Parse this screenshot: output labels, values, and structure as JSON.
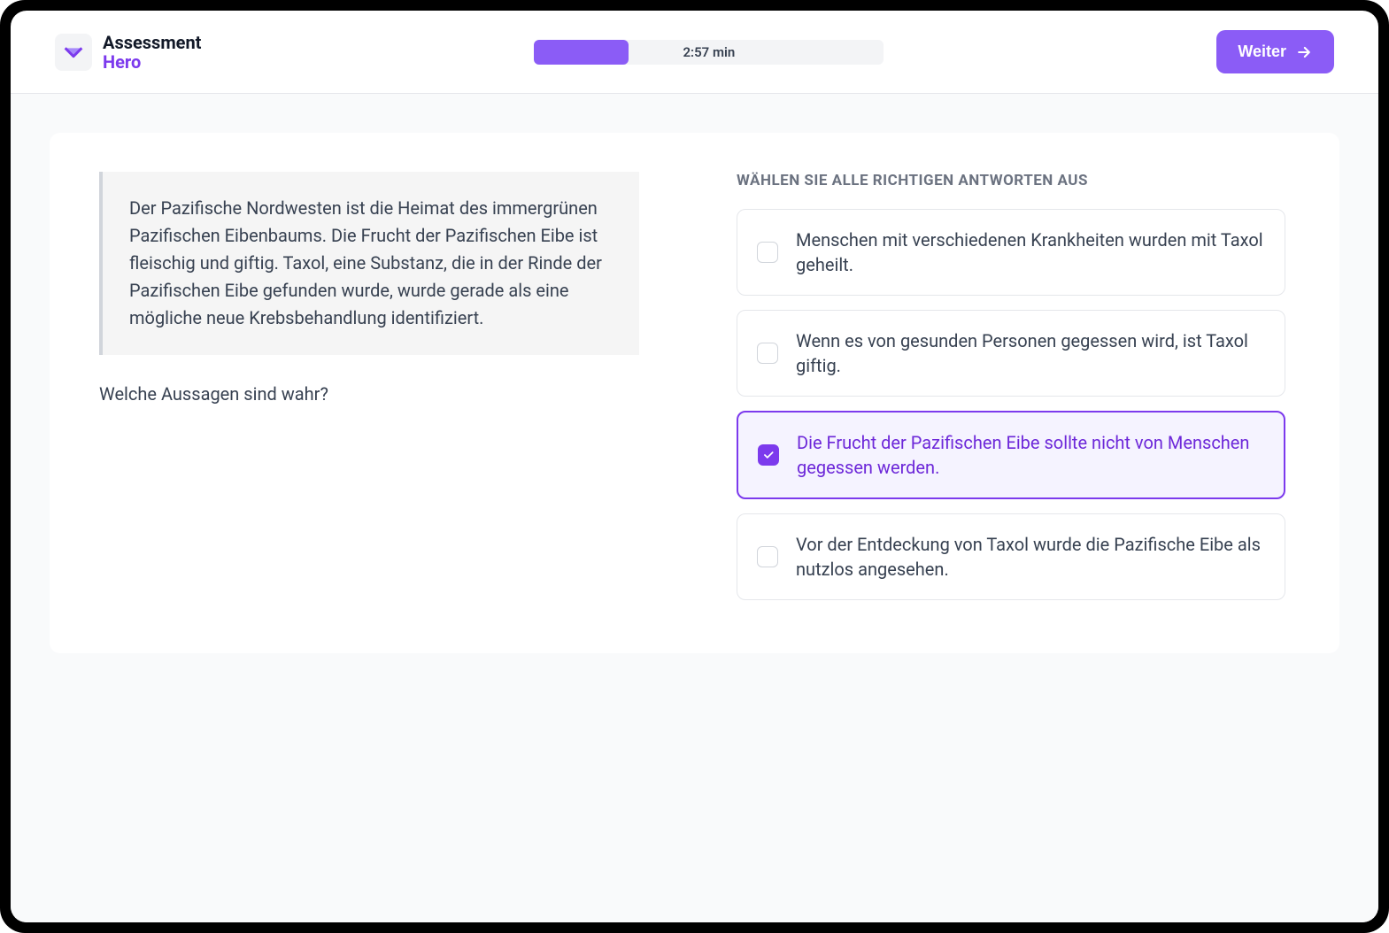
{
  "header": {
    "logo": {
      "line1": "Assessment",
      "line2": "Hero"
    },
    "timer": "2:57 min",
    "next_button": "Weiter"
  },
  "question": {
    "passage": "Der Pazifische Nordwesten ist die Heimat des immergrünen Pazifischen Eibenbaums. Die Frucht der Pazifischen Eibe ist fleischig und giftig. Taxol, eine Substanz, die in der Rinde der Pazifischen Eibe gefunden wurde, wurde gerade als eine mögliche neue Krebsbehandlung identifiziert.",
    "prompt": "Welche Aussagen sind wahr?",
    "instruction": "WÄHLEN SIE ALLE RICHTIGEN ANTWORTEN AUS",
    "options": [
      {
        "text": "Menschen mit verschiedenen Krankheiten wurden mit Taxol geheilt.",
        "selected": false
      },
      {
        "text": "Wenn es von gesunden Personen gegessen wird, ist Taxol giftig.",
        "selected": false
      },
      {
        "text": "Die Frucht der Pazifischen Eibe sollte nicht von Menschen gegessen werden.",
        "selected": true
      },
      {
        "text": "Vor der Entdeckung von Taxol wurde die Pazifische Eibe als nutzlos angesehen.",
        "selected": false
      }
    ]
  }
}
